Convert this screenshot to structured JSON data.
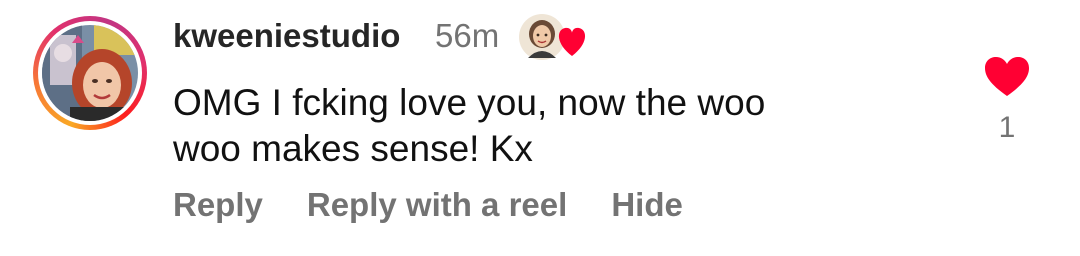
{
  "comment": {
    "username": "kweeniestudio",
    "timestamp": "56m",
    "text_line1": "OMG I fcking love you, now the woo",
    "text_line2": "woo makes sense! Kx",
    "likes": "1",
    "liked": true,
    "accent_color": "#ff0033"
  },
  "actions": {
    "reply": "Reply",
    "reply_with_reel": "Reply with a reel",
    "hide": "Hide"
  },
  "icons": {
    "like": "heart-filled-icon",
    "sticker": "avatar-heart-sticker"
  }
}
